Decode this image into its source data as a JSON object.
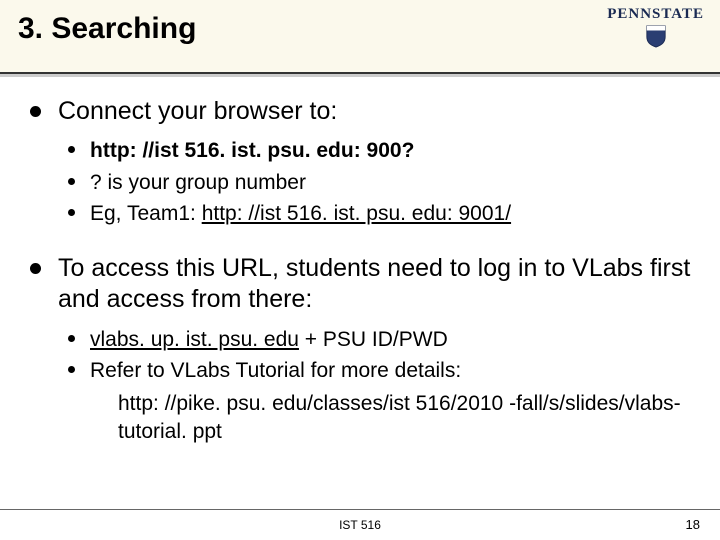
{
  "title": "3. Searching",
  "logo": {
    "text": "PENNSTATE"
  },
  "bullets": [
    {
      "text": "Connect your browser to:",
      "children": [
        {
          "text": "http: //ist 516. ist. psu. edu: 900?",
          "bold": true
        },
        {
          "text": "? is your group number"
        },
        {
          "prefix": "Eg, Team1: ",
          "link": "http: //ist 516. ist. psu. edu: 9001/"
        }
      ]
    },
    {
      "text": "To access this URL, students need to log in to VLabs first and access from there:",
      "children": [
        {
          "link_prefix": "vlabs. up. ist. psu. edu",
          "suffix": " + PSU ID/PWD"
        },
        {
          "text": "Refer to VLabs Tutorial for more details:"
        }
      ],
      "indent_block": "http: //pike. psu. edu/classes/ist 516/2010 -fall/s/slides/vlabs-tutorial. ppt"
    }
  ],
  "footer": {
    "center": "IST 516",
    "page": "18"
  }
}
